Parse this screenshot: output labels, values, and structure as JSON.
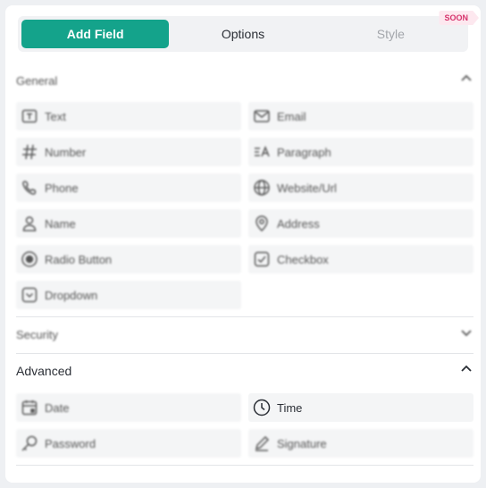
{
  "tabs": {
    "add_field": "Add Field",
    "options": "Options",
    "style": "Style",
    "soon_badge": "SOON"
  },
  "sections": {
    "general": {
      "title": "General",
      "items": [
        "Text",
        "Email",
        "Number",
        "Paragraph",
        "Phone",
        "Website/Url",
        "Name",
        "Address",
        "Radio Button",
        "Checkbox",
        "Dropdown"
      ]
    },
    "security": {
      "title": "Security"
    },
    "advanced": {
      "title": "Advanced",
      "items": [
        "Date",
        "Time",
        "Password",
        "Signature"
      ]
    }
  },
  "colors": {
    "accent": "#14a38b",
    "soon_bg": "#fde8ef",
    "soon_text": "#d6336c"
  }
}
